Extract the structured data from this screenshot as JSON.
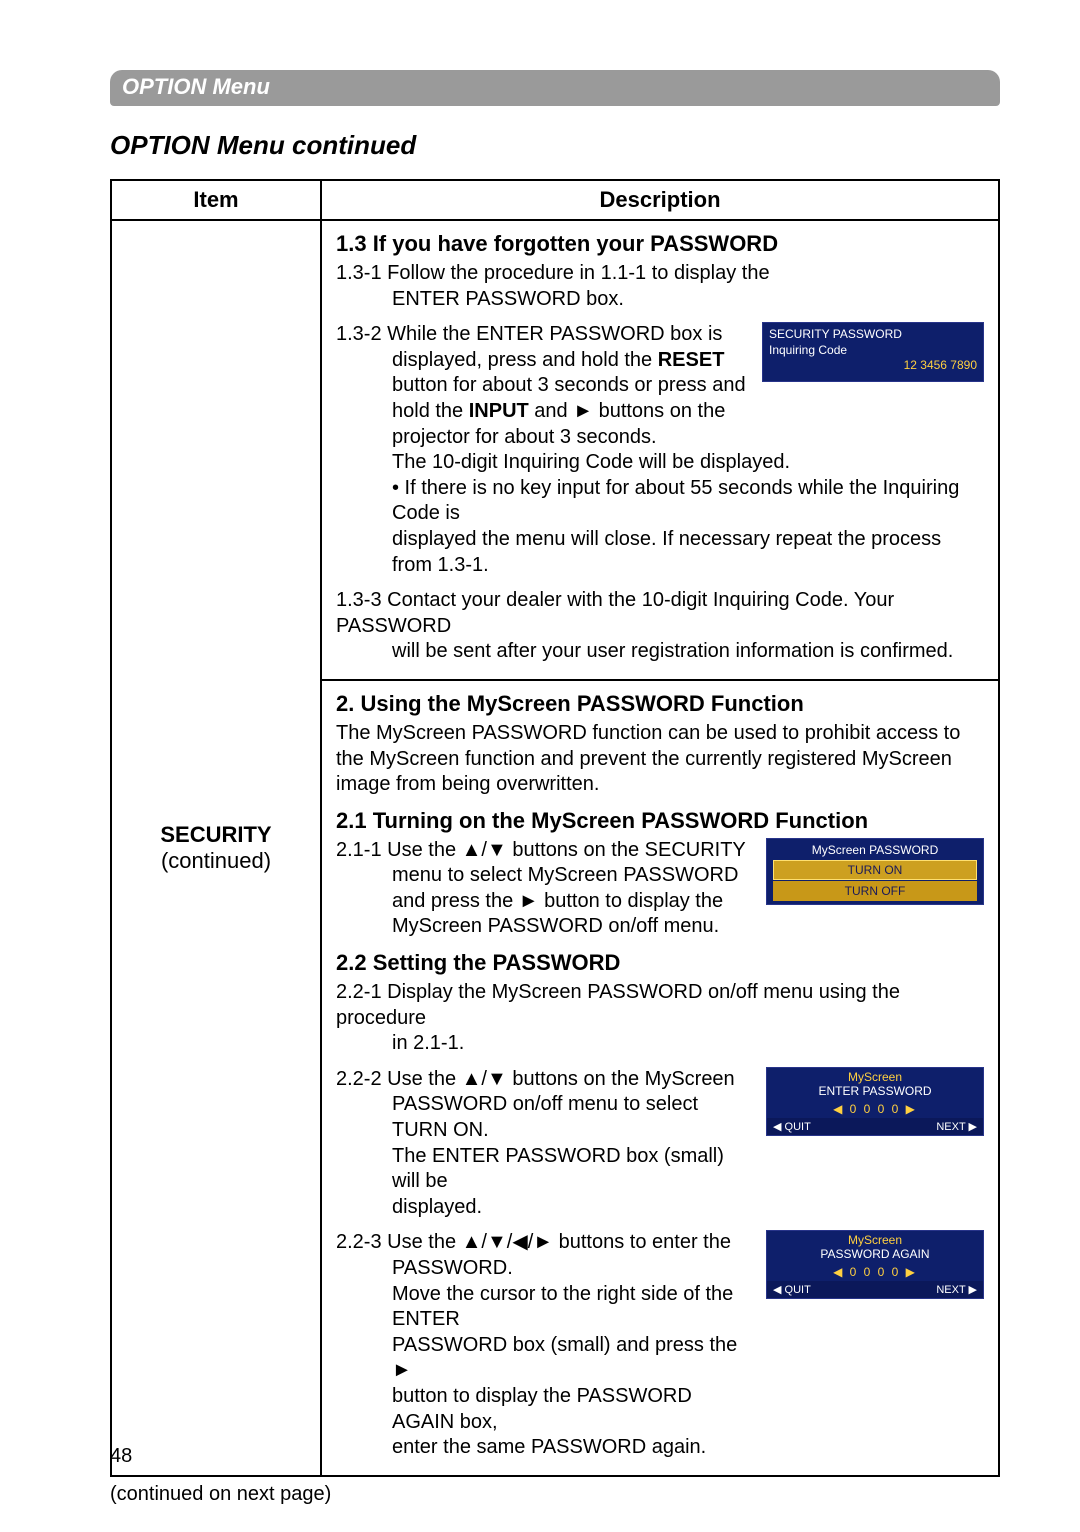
{
  "banner": "OPTION Menu",
  "subtitle": "OPTION Menu continued",
  "table": {
    "col_item": "Item",
    "col_desc": "Description",
    "item_main": "SECURITY",
    "item_sub": "(continued)"
  },
  "sec1": {
    "h": "1.3 If you have forgotten your PASSWORD",
    "p1a": "1.3-1 Follow the procedure in 1.1-1 to display the",
    "p1b": "ENTER PASSWORD box.",
    "p2_pre": "1.3-2 While the ENTER PASSWORD box is",
    "p2_l2": "displayed, press and hold the ",
    "p2_reset": "RESET",
    "p2_l3": "button for about 3 seconds or press and",
    "p2_l4a": "hold the ",
    "p2_input": "INPUT",
    "p2_l4b": " and ► buttons on the",
    "p2_l5": "projector for about 3 seconds.",
    "p2_l6": "The 10-digit Inquiring Code will be displayed.",
    "p2_bullet1": "• If there is no key input for about 55 seconds while the Inquiring Code is",
    "p2_bullet2": "displayed the menu will close. If necessary repeat the process from 1.3-1.",
    "p3a": "1.3-3 Contact your dealer with the 10-digit Inquiring Code. Your PASSWORD",
    "p3b": "will be sent after your user registration information is confirmed.",
    "panel_title": "SECURITY PASSWORD",
    "panel_sub": "Inquiring Code",
    "panel_code": "12 3456 7890"
  },
  "sec2": {
    "h": "2. Using the MyScreen PASSWORD Function",
    "p1": "The MyScreen PASSWORD function can be used to prohibit access to the MyScreen function and prevent the currently registered MyScreen image from being overwritten.",
    "h21": "2.1 Turning on the MyScreen PASSWORD Function",
    "p211": "2.1-1 Use the ▲/▼ buttons on the SECURITY",
    "p211b": "menu to select MyScreen PASSWORD",
    "p211c": "and press the ► button to display the",
    "p211d": "MyScreen PASSWORD on/off menu.",
    "panel21_title": "MyScreen PASSWORD",
    "panel21_on": "TURN ON",
    "panel21_off": "TURN OFF",
    "h22": "2.2 Setting the PASSWORD",
    "p221": "2.2-1 Display the MyScreen PASSWORD on/off menu using the procedure",
    "p221b": "in 2.1-1.",
    "p222a": "2.2-2 Use the ▲/▼ buttons on the MyScreen",
    "p222b": "PASSWORD on/off menu to select TURN ON.",
    "p222c": "The ENTER PASSWORD box (small) will be",
    "p222d": "displayed.",
    "panel222_t1": "MyScreen",
    "panel222_t2": "ENTER PASSWORD",
    "panel222_digits": "◀ 0 0 0 0 ▶",
    "panel222_quit": "◀ QUIT",
    "panel222_next": "NEXT ▶",
    "p223a": "2.2-3 Use the ▲/▼/◀/► buttons to enter the",
    "p223b": "PASSWORD.",
    "p223c": "Move the cursor to the right side of the ENTER",
    "p223d": "PASSWORD box (small) and press the ►",
    "p223e": "button to display the PASSWORD AGAIN box,",
    "p223f": "enter the same PASSWORD again.",
    "panel223_t1": "MyScreen",
    "panel223_t2": "PASSWORD AGAIN",
    "panel223_digits": "◀ 0 0 0 0 ▶",
    "panel223_quit": "◀ QUIT",
    "panel223_next": "NEXT ▶"
  },
  "footer_note": "(continued on next page)",
  "page_number": "48"
}
